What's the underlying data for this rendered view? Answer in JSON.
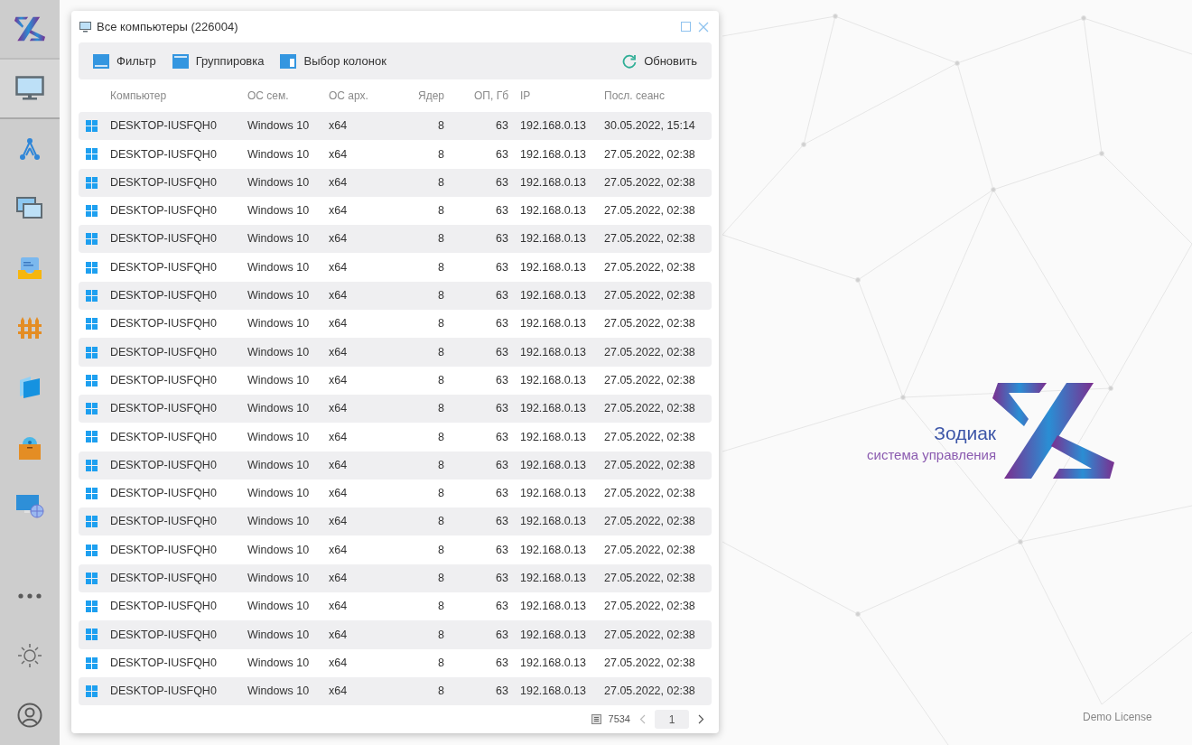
{
  "sidebar": {
    "items": [
      {
        "kind": "monitor",
        "selected": true
      },
      {
        "kind": "network",
        "selected": false
      },
      {
        "kind": "windows",
        "selected": false
      },
      {
        "kind": "inbox",
        "selected": false
      },
      {
        "kind": "fence",
        "selected": false
      },
      {
        "kind": "cubes",
        "selected": false
      },
      {
        "kind": "box",
        "selected": false
      },
      {
        "kind": "globe",
        "selected": false
      }
    ],
    "bottom": [
      {
        "kind": "more"
      },
      {
        "kind": "settings"
      },
      {
        "kind": "user"
      }
    ]
  },
  "window": {
    "title": "Все компьютеры (226004)"
  },
  "toolbar": {
    "buttons": [
      {
        "kind": "filter",
        "label": "Фильтр"
      },
      {
        "kind": "group",
        "label": "Группировка"
      },
      {
        "kind": "columns",
        "label": "Выбор колонок"
      }
    ],
    "refresh": "Обновить"
  },
  "table": {
    "columns": [
      "Компьютер",
      "ОС сем.",
      "ОС арх.",
      "Ядер",
      "ОП, Гб",
      "IP",
      "Посл. сеанс"
    ],
    "rows": [
      [
        "DESKTOP-IUSFQH0",
        "Windows 10",
        "x64",
        "8",
        "63",
        "192.168.0.13",
        "30.05.2022, 15:14"
      ],
      [
        "DESKTOP-IUSFQH0",
        "Windows 10",
        "x64",
        "8",
        "63",
        "192.168.0.13",
        "27.05.2022, 02:38"
      ],
      [
        "DESKTOP-IUSFQH0",
        "Windows 10",
        "x64",
        "8",
        "63",
        "192.168.0.13",
        "27.05.2022, 02:38"
      ],
      [
        "DESKTOP-IUSFQH0",
        "Windows 10",
        "x64",
        "8",
        "63",
        "192.168.0.13",
        "27.05.2022, 02:38"
      ],
      [
        "DESKTOP-IUSFQH0",
        "Windows 10",
        "x64",
        "8",
        "63",
        "192.168.0.13",
        "27.05.2022, 02:38"
      ],
      [
        "DESKTOP-IUSFQH0",
        "Windows 10",
        "x64",
        "8",
        "63",
        "192.168.0.13",
        "27.05.2022, 02:38"
      ],
      [
        "DESKTOP-IUSFQH0",
        "Windows 10",
        "x64",
        "8",
        "63",
        "192.168.0.13",
        "27.05.2022, 02:38"
      ],
      [
        "DESKTOP-IUSFQH0",
        "Windows 10",
        "x64",
        "8",
        "63",
        "192.168.0.13",
        "27.05.2022, 02:38"
      ],
      [
        "DESKTOP-IUSFQH0",
        "Windows 10",
        "x64",
        "8",
        "63",
        "192.168.0.13",
        "27.05.2022, 02:38"
      ],
      [
        "DESKTOP-IUSFQH0",
        "Windows 10",
        "x64",
        "8",
        "63",
        "192.168.0.13",
        "27.05.2022, 02:38"
      ],
      [
        "DESKTOP-IUSFQH0",
        "Windows 10",
        "x64",
        "8",
        "63",
        "192.168.0.13",
        "27.05.2022, 02:38"
      ],
      [
        "DESKTOP-IUSFQH0",
        "Windows 10",
        "x64",
        "8",
        "63",
        "192.168.0.13",
        "27.05.2022, 02:38"
      ],
      [
        "DESKTOP-IUSFQH0",
        "Windows 10",
        "x64",
        "8",
        "63",
        "192.168.0.13",
        "27.05.2022, 02:38"
      ],
      [
        "DESKTOP-IUSFQH0",
        "Windows 10",
        "x64",
        "8",
        "63",
        "192.168.0.13",
        "27.05.2022, 02:38"
      ],
      [
        "DESKTOP-IUSFQH0",
        "Windows 10",
        "x64",
        "8",
        "63",
        "192.168.0.13",
        "27.05.2022, 02:38"
      ],
      [
        "DESKTOP-IUSFQH0",
        "Windows 10",
        "x64",
        "8",
        "63",
        "192.168.0.13",
        "27.05.2022, 02:38"
      ],
      [
        "DESKTOP-IUSFQH0",
        "Windows 10",
        "x64",
        "8",
        "63",
        "192.168.0.13",
        "27.05.2022, 02:38"
      ],
      [
        "DESKTOP-IUSFQH0",
        "Windows 10",
        "x64",
        "8",
        "63",
        "192.168.0.13",
        "27.05.2022, 02:38"
      ],
      [
        "DESKTOP-IUSFQH0",
        "Windows 10",
        "x64",
        "8",
        "63",
        "192.168.0.13",
        "27.05.2022, 02:38"
      ],
      [
        "DESKTOP-IUSFQH0",
        "Windows 10",
        "x64",
        "8",
        "63",
        "192.168.0.13",
        "27.05.2022, 02:38"
      ],
      [
        "DESKTOP-IUSFQH0",
        "Windows 10",
        "x64",
        "8",
        "63",
        "192.168.0.13",
        "27.05.2022, 02:38"
      ]
    ]
  },
  "pagination": {
    "total": "7534",
    "page": "1"
  },
  "brand": {
    "name": "Зодиак",
    "subtitle": "система управления"
  },
  "license": "Demo License"
}
